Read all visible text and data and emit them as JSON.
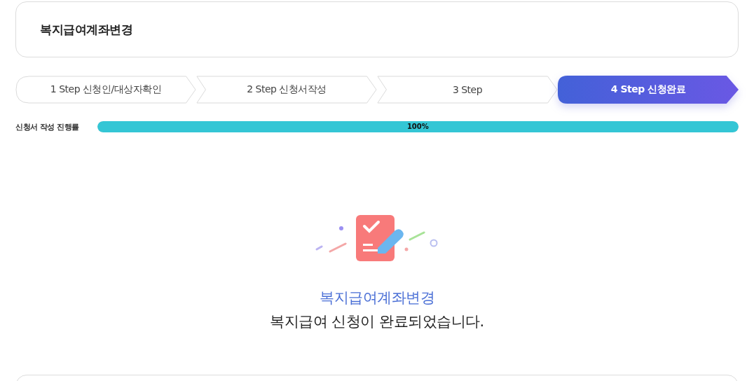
{
  "page_title": "복지급여계좌변경",
  "steps": [
    {
      "label": "1 Step 신청인/대상자확인",
      "selected": false
    },
    {
      "label": "2 Step 신청서작성",
      "selected": false
    },
    {
      "label": "3 Step",
      "selected": false
    },
    {
      "label": "4 Step 신청완료",
      "selected": true
    }
  ],
  "progress": {
    "label": "신청서 작성 진행률",
    "level": 1,
    "reading": "100%"
  },
  "result": {
    "title": "복지급여계좌변경",
    "message": "복지급여 신청이 완료되었습니다."
  }
}
